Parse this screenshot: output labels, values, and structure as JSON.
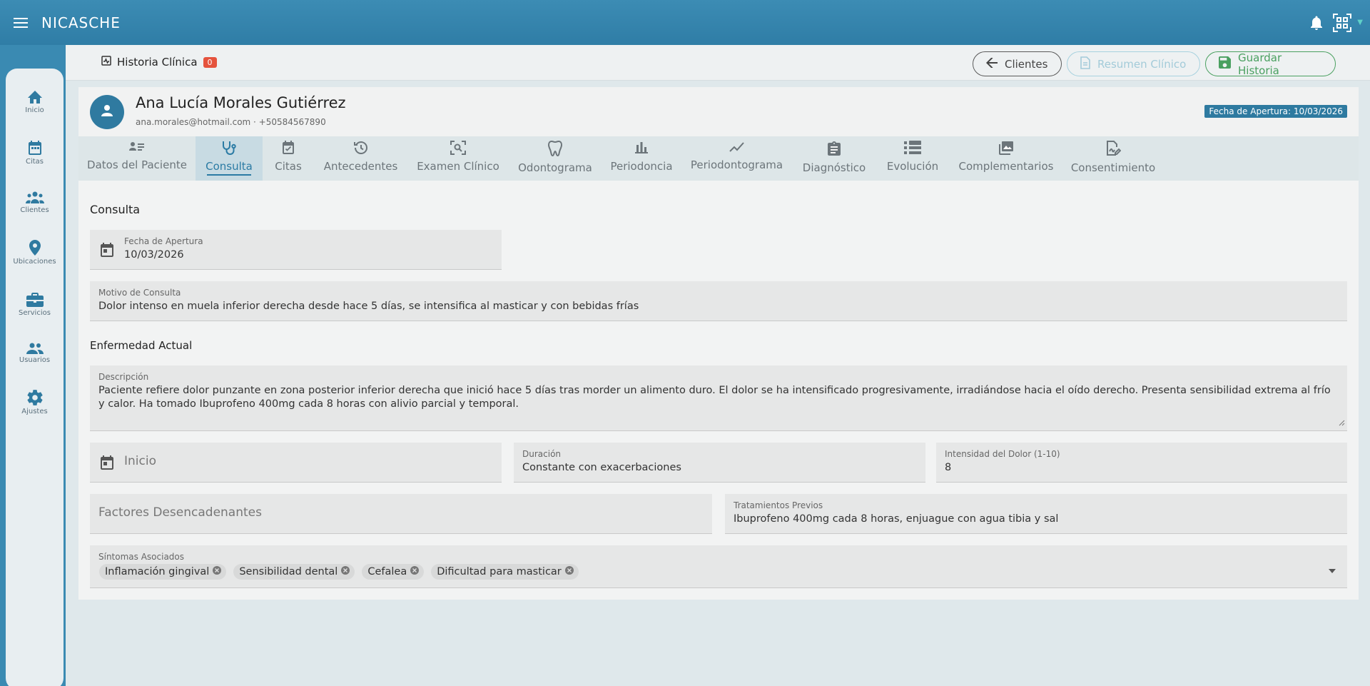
{
  "app": {
    "title": "NICASCHE",
    "menu_icon": "menu-icon",
    "right_icons": [
      "bell-icon",
      "qr-code-icon",
      "chevron-down-icon"
    ]
  },
  "sidebar": {
    "items": [
      {
        "label": "Inicio",
        "icon": "home-icon"
      },
      {
        "label": "Citas",
        "icon": "calendar-icon"
      },
      {
        "label": "Clientes",
        "icon": "groups-icon"
      },
      {
        "label": "Ubicaciones",
        "icon": "location-pin-icon"
      },
      {
        "label": "Servicios",
        "icon": "briefcase-icon"
      },
      {
        "label": "Usuarios",
        "icon": "people-icon"
      },
      {
        "label": "Ajustes",
        "icon": "gear-icon"
      }
    ]
  },
  "header": {
    "title": "Historia Clínica",
    "badge": "0",
    "buttons": {
      "clientes": "Clientes",
      "resumen": "Resumen Clínico",
      "guardar": "Guardar Historia"
    }
  },
  "patient": {
    "name": "Ana Lucía Morales Gutiérrez",
    "contact": "ana.morales@hotmail.com · +50584567890",
    "opening_badge": "Fecha de Apertura: 10/03/2026"
  },
  "tabs": [
    {
      "label": "Datos del Paciente",
      "icon": "person-list-icon"
    },
    {
      "label": "Consulta",
      "icon": "stethoscope-icon",
      "active": true
    },
    {
      "label": "Citas",
      "icon": "calendar-check-icon"
    },
    {
      "label": "Antecedentes",
      "icon": "history-icon"
    },
    {
      "label": "Examen Clínico",
      "icon": "scan-search-icon"
    },
    {
      "label": "Odontograma",
      "icon": "tooth-icon"
    },
    {
      "label": "Periodoncia",
      "icon": "bar-chart-icon"
    },
    {
      "label": "Periodontograma",
      "icon": "line-chart-icon"
    },
    {
      "label": "Diagnóstico",
      "icon": "clipboard-icon"
    },
    {
      "label": "Evolución",
      "icon": "list-numbered-icon"
    },
    {
      "label": "Complementarios",
      "icon": "image-gallery-icon"
    },
    {
      "label": "Consentimiento",
      "icon": "signature-icon"
    }
  ],
  "consulta": {
    "section_title": "Consulta",
    "fecha_apertura": {
      "label": "Fecha de Apertura",
      "value": "10/03/2026"
    },
    "motivo": {
      "label": "Motivo de Consulta",
      "value": "Dolor intenso en muela inferior derecha desde hace 5 días, se intensifica al masticar y con bebidas frías"
    },
    "enfermedad_title": "Enfermedad Actual",
    "descripcion": {
      "label": "Descripción",
      "value": "Paciente refiere dolor punzante en zona posterior inferior derecha que inició hace 5 días tras morder un alimento duro. El dolor se ha intensificado progresivamente, irradiándose hacia el oído derecho. Presenta sensibilidad extrema al frío y calor. Ha tomado Ibuprofeno 400mg cada 8 horas con alivio parcial y temporal."
    },
    "inicio": {
      "placeholder": "Inicio"
    },
    "duracion": {
      "label": "Duración",
      "value": "Constante con exacerbaciones"
    },
    "intensidad": {
      "label": "Intensidad del Dolor (1-10)",
      "value": "8"
    },
    "factores": {
      "placeholder": "Factores Desencadenantes"
    },
    "tratamientos": {
      "label": "Tratamientos Previos",
      "value": "Ibuprofeno 400mg cada 8 horas, enjuague con agua tibia y sal"
    },
    "sintomas": {
      "label": "Síntomas Asociados",
      "chips": [
        "Inflamación gingival",
        "Sensibilidad dental",
        "Cefalea",
        "Dificultad para masticar"
      ]
    }
  }
}
